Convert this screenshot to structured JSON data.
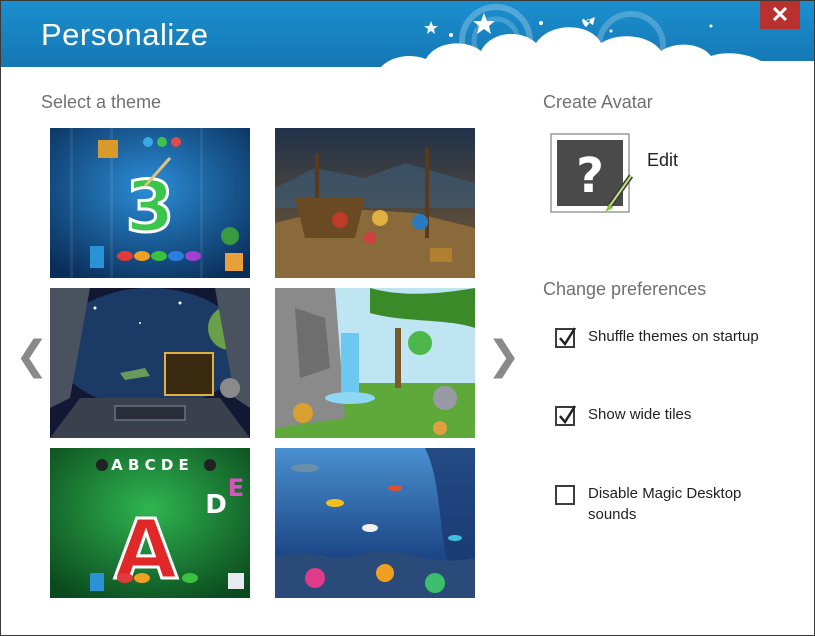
{
  "window": {
    "title": "Personalize",
    "close_glyph": "✕",
    "accent_color": "#1684c4",
    "close_color": "#b8312e"
  },
  "themes": {
    "label": "Select a theme",
    "prev_glyph": "❮",
    "next_glyph": "❯",
    "tiles": [
      {
        "name": "numbers-paint"
      },
      {
        "name": "pirates"
      },
      {
        "name": "spaceship"
      },
      {
        "name": "jungle"
      },
      {
        "name": "alphabet-paint"
      },
      {
        "name": "underwater"
      }
    ]
  },
  "avatar": {
    "label": "Create Avatar",
    "icon": "question-mark-avatar-icon",
    "edit_label": "Edit"
  },
  "preferences": {
    "label": "Change preferences",
    "items": [
      {
        "label": "Shuffle themes on startup",
        "checked": true
      },
      {
        "label": "Show wide tiles",
        "checked": true
      },
      {
        "label": "Disable Magic Desktop sounds",
        "checked": false
      }
    ]
  }
}
